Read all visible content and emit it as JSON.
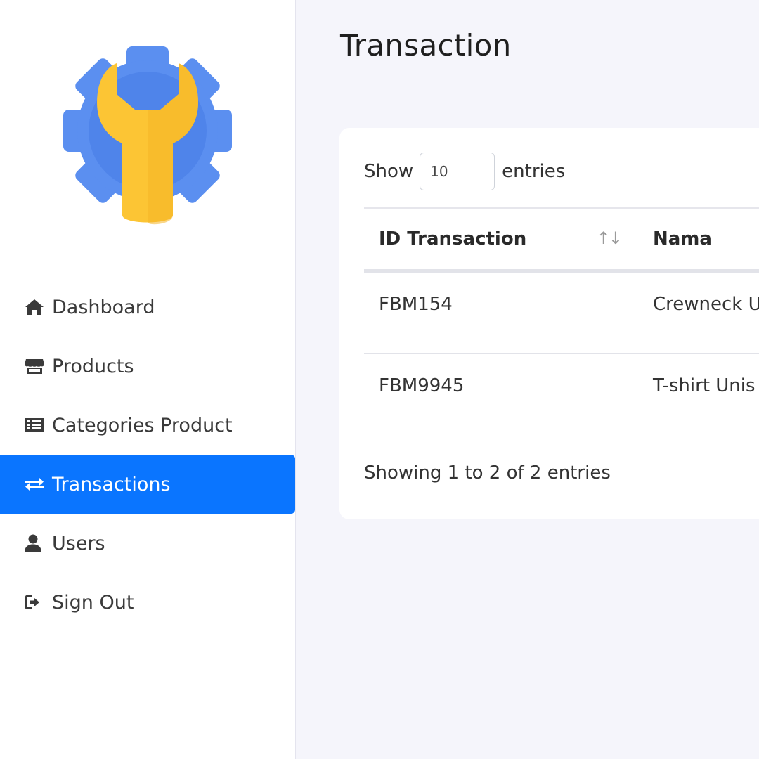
{
  "sidebar": {
    "logo_icon": "gear-wrench-icon",
    "items": [
      {
        "label": "Dashboard",
        "icon": "home-icon",
        "active": false
      },
      {
        "label": "Products",
        "icon": "store-icon",
        "active": false
      },
      {
        "label": "Categories Product",
        "icon": "list-icon",
        "active": false
      },
      {
        "label": "Transactions",
        "icon": "exchange-icon",
        "active": true
      },
      {
        "label": "Users",
        "icon": "user-icon",
        "active": false
      },
      {
        "label": "Sign Out",
        "icon": "sign-out-icon",
        "active": false
      }
    ]
  },
  "colors": {
    "accent": "#0a75ff",
    "logo_gear": "#5b8ff0",
    "logo_wrench": "#fcc534"
  },
  "page": {
    "title": "Transaction"
  },
  "table": {
    "show_label": "Show",
    "length_value": "10",
    "entries_label": "entries",
    "columns": [
      "ID Transaction",
      "Nama"
    ],
    "sort_icon": "sort-icon",
    "rows": [
      {
        "id": "FBM154",
        "nama": "Crewneck U"
      },
      {
        "id": "FBM9945",
        "nama": "T-shirt Unis"
      }
    ],
    "info": "Showing 1 to 2 of 2 entries"
  }
}
